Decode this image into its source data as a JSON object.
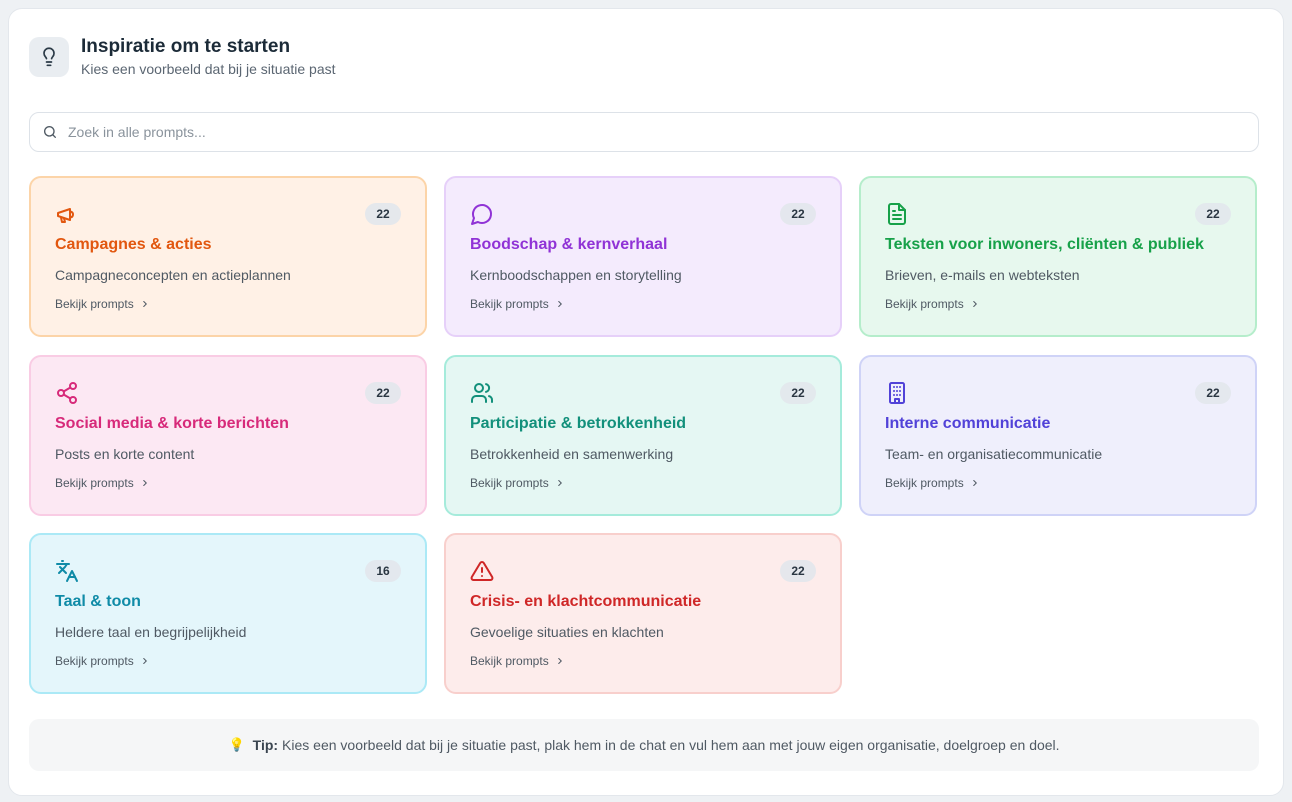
{
  "header": {
    "icon": "lightbulb-icon",
    "title": "Inspiratie om te starten",
    "subtitle": "Kies een voorbeeld dat bij je situatie past"
  },
  "search": {
    "icon": "search-icon",
    "placeholder": "Zoek in alle prompts..."
  },
  "cards": [
    {
      "icon": "megaphone-icon",
      "title": "Campagnes & acties",
      "description": "Campagneconcepten en actieplannen",
      "count": "22",
      "link": "Bekijk prompts",
      "accent": "#e2570f"
    },
    {
      "icon": "chat-bubble-icon",
      "title": "Boodschap & kernverhaal",
      "description": "Kernboodschappen en storytelling",
      "count": "22",
      "link": "Bekijk prompts",
      "accent": "#9033d6"
    },
    {
      "icon": "document-icon",
      "title": "Teksten voor inwoners, cliënten & publiek",
      "description": "Brieven, e-mails en webteksten",
      "count": "22",
      "link": "Bekijk prompts",
      "accent": "#17a149"
    },
    {
      "icon": "share-icon",
      "title": "Social media & korte berichten",
      "description": "Posts en korte content",
      "count": "22",
      "link": "Bekijk prompts",
      "accent": "#d72a7a"
    },
    {
      "icon": "users-icon",
      "title": "Participatie & betrokkenheid",
      "description": "Betrokkenheid en samenwerking",
      "count": "22",
      "link": "Bekijk prompts",
      "accent": "#12907b"
    },
    {
      "icon": "building-icon",
      "title": "Interne communicatie",
      "description": "Team- en organisatiecommunicatie",
      "count": "22",
      "link": "Bekijk prompts",
      "accent": "#5142d8"
    },
    {
      "icon": "translate-icon",
      "title": "Taal & toon",
      "description": "Heldere taal en begrijpelijkheid",
      "count": "16",
      "link": "Bekijk prompts",
      "accent": "#0f8ba7"
    },
    {
      "icon": "warning-icon",
      "title": "Crisis- en klachtcommunicatie",
      "description": "Gevoelige situaties en klachten",
      "count": "22",
      "link": "Bekijk prompts",
      "accent": "#cf2727"
    }
  ],
  "tip": {
    "icon": "lightbulb-emoji-icon",
    "label": "Tip:",
    "text": "Kies een voorbeeld dat bij je situatie past, plak hem in de chat en vul hem aan met jouw eigen organisatie, doelgroep en doel."
  }
}
